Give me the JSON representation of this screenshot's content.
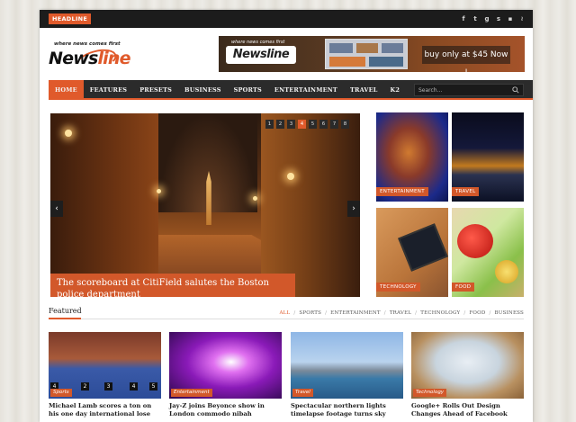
{
  "topbar": {
    "headline_label": "HEADLINE",
    "social_icons": [
      "facebook-icon",
      "twitter-icon",
      "google-plus-icon",
      "skype-icon",
      "flickr-icon",
      "rss-icon"
    ]
  },
  "logo": {
    "tagline": "where news comes first",
    "name_part1": "News",
    "name_part2": "line"
  },
  "banner": {
    "tagline": "where news comes first",
    "logo_text": "Newsline",
    "cta": "buy only at $45 Now !"
  },
  "nav": {
    "items": [
      {
        "label": "HOME",
        "active": true
      },
      {
        "label": "FEATURES",
        "active": false
      },
      {
        "label": "PRESETS",
        "active": false
      },
      {
        "label": "BUSINESS",
        "active": false
      },
      {
        "label": "SPORTS",
        "active": false
      },
      {
        "label": "ENTERTAINMENT",
        "active": false
      },
      {
        "label": "TRAVEL",
        "active": false
      },
      {
        "label": "K2",
        "active": false
      }
    ],
    "search_placeholder": "Search..."
  },
  "slider": {
    "pages": [
      "1",
      "2",
      "3",
      "4",
      "5",
      "6",
      "7",
      "8"
    ],
    "active_page": "4",
    "caption": "The scoreboard at CitiField salutes the Boston police department"
  },
  "tiles": [
    {
      "label": "ENTERTAINMENT"
    },
    {
      "label": "TRAVEL"
    },
    {
      "label": "TECHNOLOGY"
    },
    {
      "label": "FOOD"
    }
  ],
  "featured": {
    "title": "Featured",
    "filters": [
      "ALL",
      "SPORTS",
      "ENTERTAINMENT",
      "TRAVEL",
      "TECHNOLOGY",
      "FOOD",
      "BUSINESS"
    ],
    "cards": [
      {
        "category": "Sports",
        "title": "Michael Lamb scores a ton on his one day international lose"
      },
      {
        "category": "Entertainment",
        "title": "Jay-Z joins Beyonce show in London commodo nibah"
      },
      {
        "category": "Travel",
        "title": "Spectacular northern lights timelapse footage turns sky"
      },
      {
        "category": "Technology",
        "title": "Google+ Rolls Out Design Changes Ahead of Facebook"
      }
    ]
  },
  "colors": {
    "accent": "#e05a2b",
    "dark": "#2b2b2b"
  }
}
